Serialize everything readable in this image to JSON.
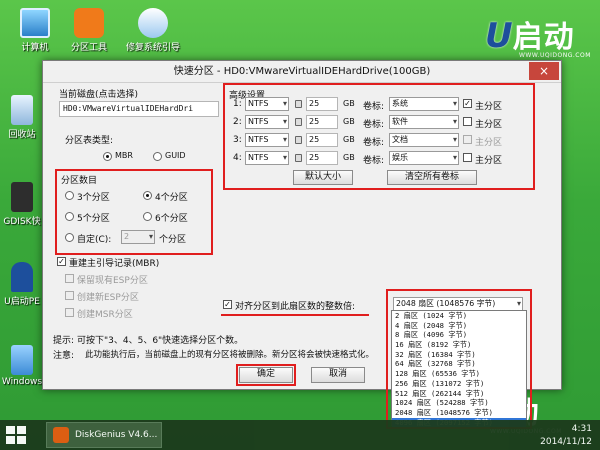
{
  "desktop": {
    "icons": [
      {
        "label": "计算机",
        "icon": "computer-icon"
      },
      {
        "label": "分区工具",
        "icon": "diskgenius-icon"
      },
      {
        "label": "修复系统引导",
        "icon": "repair-boot-icon"
      },
      {
        "label": "回收站",
        "icon": "recycle-bin-icon"
      },
      {
        "label": "GDISK快",
        "icon": "gdisk-icon"
      },
      {
        "label": "U启动PE",
        "icon": "uqidong-pe-icon"
      },
      {
        "label": "Windows",
        "icon": "windows-installer-icon"
      }
    ],
    "logo_text": "启动",
    "logo_url": "WWW.UQIDONG.COM"
  },
  "dialog": {
    "title": "快速分区 - HD0:VMwareVirtualIDEHardDrive(100GB)",
    "close_symbol": "×",
    "current_disk_label": "当前磁盘(点击选择)",
    "current_disk_value": "HD0:VMwareVirtualIDEHardDri",
    "partition_table_label": "分区表类型:",
    "table_types": [
      "MBR",
      "GUID"
    ],
    "selected_table_type": "MBR",
    "partition_count_label": "分区数目",
    "count_options": [
      "3个分区",
      "4个分区",
      "5个分区",
      "6个分区"
    ],
    "selected_count": "4个分区",
    "custom_label": "自定(C):",
    "custom_value": "2",
    "custom_suffix": "个分区",
    "rebuild_mbr": "重建主引导记录(MBR)",
    "keep_esp": "保留现有ESP分区",
    "create_esp": "创建新ESP分区",
    "create_msr": "创建MSR分区",
    "advanced_label": "高级设置",
    "partitions": [
      {
        "num": "1:",
        "fs": "NTFS",
        "size": "25",
        "unit": "GB",
        "vol_label": "卷标:",
        "name": "系统",
        "primary": "主分区",
        "primary_checked": true,
        "primary_enabled": true
      },
      {
        "num": "2:",
        "fs": "NTFS",
        "size": "25",
        "unit": "GB",
        "vol_label": "卷标:",
        "name": "软件",
        "primary": "主分区",
        "primary_checked": false,
        "primary_enabled": true
      },
      {
        "num": "3:",
        "fs": "NTFS",
        "size": "25",
        "unit": "GB",
        "vol_label": "卷标:",
        "name": "文档",
        "primary": "主分区",
        "primary_checked": false,
        "primary_enabled": false
      },
      {
        "num": "4:",
        "fs": "NTFS",
        "size": "25",
        "unit": "GB",
        "vol_label": "卷标:",
        "name": "娱乐",
        "primary": "主分区",
        "primary_checked": false,
        "primary_enabled": true
      }
    ],
    "default_size_button": "默认大小",
    "clear_labels_button": "清空所有卷标",
    "align_label": "对齐分区到此扇区数的整数倍:",
    "align_selected": "2048 扇区 (1048576 字节)",
    "align_options": [
      "2 扇区 (1024 字节)",
      "4 扇区 (2048 字节)",
      "8 扇区 (4096 字节)",
      "16 扇区 (8192 字节)",
      "32 扇区 (16384 字节)",
      "64 扇区 (32768 字节)",
      "128 扇区 (65536 字节)",
      "256 扇区 (131072 字节)",
      "512 扇区 (262144 字节)",
      "1024 扇区 (524288 字节)",
      "2048 扇区 (1048576 字节)",
      "4096 扇区 (2097152 字节)"
    ],
    "highlighted_option": "4096 扇区 (2097152 字节)",
    "tip_label": "提示:",
    "tip_text": "可按下\"3、4、5、6\"快速选择分区个数。",
    "note_label": "注意:",
    "note_text": "此功能执行后，当前磁盘上的现有分区将被删除。新分区将会被快速格式化。",
    "ok_button": "确定",
    "cancel_button": "取消"
  },
  "taskbar": {
    "app_label": "DiskGenius V4.6...",
    "time": "4:31",
    "date": "2014/11/12"
  },
  "colors": {
    "highlight_red": "#e01e1e",
    "selection_blue": "#3075d6",
    "desktop_green": "#3aa93a"
  }
}
